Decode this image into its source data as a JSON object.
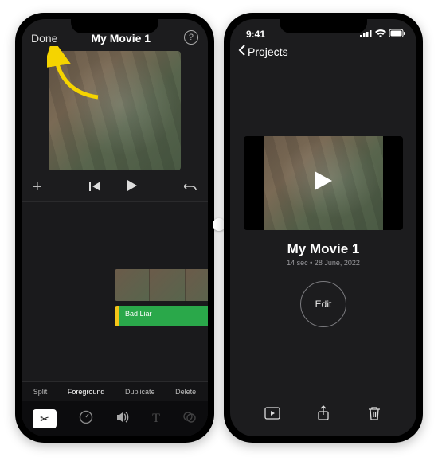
{
  "left": {
    "done_label": "Done",
    "title": "My Movie 1",
    "help_glyph": "?",
    "add_glyph": "+",
    "skip_back_glyph": "⏮",
    "play_glyph": "▶",
    "undo_glyph": "↩",
    "audio_clip_title": "Bad Liar",
    "clip_actions": {
      "split": "Split",
      "foreground": "Foreground",
      "duplicate": "Duplicate",
      "delete": "Delete"
    },
    "tools": {
      "cut": "✂",
      "speed": "⏱",
      "volume": "🔊",
      "text": "T",
      "filters": "⧉"
    }
  },
  "right": {
    "status_time": "9:41",
    "back_label": "Projects",
    "project_title": "My Movie 1",
    "project_meta": "14 sec • 28 June, 2022",
    "edit_label": "Edit",
    "play_glyph": "▶"
  }
}
